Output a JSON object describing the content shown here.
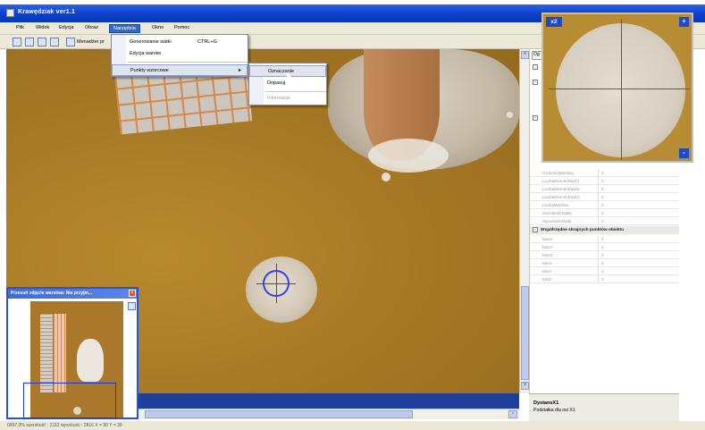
{
  "window": {
    "title": "Krawędziak ver1.1"
  },
  "menubar": {
    "items": [
      "Plik",
      "Widok",
      "Edycja",
      "Obraz",
      "Narzędzia",
      "Okno",
      "Pomoc"
    ],
    "active": "Narzędzia"
  },
  "toolbar": {
    "manager_label": "Menadżer pr"
  },
  "menu_narzedzia": {
    "items": [
      {
        "label": "Generowanie siatki",
        "shortcut": "CTRL+G"
      },
      {
        "label": "Edycja warstw",
        "shortcut": ""
      },
      {
        "label": "Punkty wzorcowe",
        "shortcut": ""
      }
    ]
  },
  "submenu_punkty": {
    "items": [
      {
        "label": "Oznaczanie",
        "enabled": true,
        "highlighted": true
      },
      {
        "label": "Dopasuj",
        "enabled": true,
        "highlighted": false
      },
      {
        "label": "Informacje",
        "enabled": false,
        "highlighted": false
      }
    ]
  },
  "overview": {
    "title": "Przesuń zdjęcie warstwa: Nie przyjm..."
  },
  "zoom": {
    "label": "x2",
    "plus": "+",
    "minus": "-"
  },
  "right_panel": {
    "tab_label": "Og",
    "props_top": [
      {
        "name": "GrubośćWarstwy",
        "value": "0"
      },
      {
        "name": "LiczbaElementówX1",
        "value": "0"
      },
      {
        "name": "LiczbaElementówX2",
        "value": "0"
      },
      {
        "name": "LiczbaElementówX3",
        "value": "0"
      },
      {
        "name": "LiczbaWęzłów",
        "value": "0"
      },
      {
        "name": "SzerokośćSiatki",
        "value": "0"
      },
      {
        "name": "WysokośćSiatki",
        "value": "0"
      }
    ],
    "section_title": "Współrzędne skrajnych punktów obiektu",
    "props_bottom": [
      {
        "name": "MaxX",
        "value": "0"
      },
      {
        "name": "MaxY",
        "value": "0"
      },
      {
        "name": "MaxZ",
        "value": "0"
      },
      {
        "name": "MinX",
        "value": "0"
      },
      {
        "name": "MinY",
        "value": "0"
      },
      {
        "name": "MinZ",
        "value": "0"
      }
    ],
    "description": {
      "title": "DystansX1",
      "text": "Podziałka dla osi X1"
    }
  },
  "statusbar": {
    "text": "0997.3%  szerokość : 2112  wysokość : 2816  X = 90  Y = 35"
  },
  "colors": {
    "titlebar": "#0a3fc9",
    "accent": "#316ac5",
    "crosshair_blue": "#3440e0",
    "crosshair_red": "#e0212a",
    "background_image": "#a97a26"
  }
}
